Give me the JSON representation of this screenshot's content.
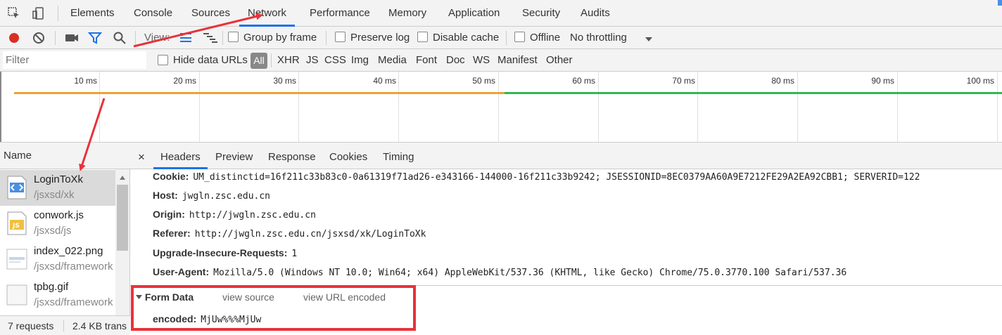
{
  "tabbar": {
    "tabs": [
      "Elements",
      "Console",
      "Sources",
      "Network",
      "Performance",
      "Memory",
      "Application",
      "Security",
      "Audits"
    ],
    "active": "Network"
  },
  "toolbar": {
    "view_label": "View:",
    "group_by_frame": "Group by frame",
    "preserve_log": "Preserve log",
    "disable_cache": "Disable cache",
    "offline": "Offline",
    "throttling": "No throttling"
  },
  "filter": {
    "placeholder": "Filter",
    "hide_data_urls": "Hide data URLs",
    "all": "All",
    "types": [
      "XHR",
      "JS",
      "CSS",
      "Img",
      "Media",
      "Font",
      "Doc",
      "WS",
      "Manifest",
      "Other"
    ]
  },
  "timeline": {
    "ticks": [
      "10 ms",
      "20 ms",
      "30 ms",
      "40 ms",
      "50 ms",
      "60 ms",
      "70 ms",
      "80 ms",
      "90 ms",
      "100 ms"
    ]
  },
  "requests": {
    "header": "Name",
    "items": [
      {
        "name": "LoginToXk",
        "path": "/jsxsd/xk",
        "selected": true
      },
      {
        "name": "conwork.js",
        "path": "/jsxsd/js",
        "selected": false
      },
      {
        "name": "index_022.png",
        "path": "/jsxsd/framework",
        "selected": false
      },
      {
        "name": "tpbg.gif",
        "path": "/jsxsd/framework",
        "selected": false
      }
    ],
    "status_count": "7 requests",
    "status_size": "2.4 KB trans"
  },
  "details": {
    "tabs": [
      "Headers",
      "Preview",
      "Response",
      "Cookies",
      "Timing"
    ],
    "active": "Headers",
    "close": "×",
    "headers": [
      {
        "key": "Cookie:",
        "value": "UM_distinctid=16f211c33b83c0-0a61319f71ad26-e343166-144000-16f211c33b9242; JSESSIONID=8EC0379AA60A9E7212FE29A2EA92CBB1; SERVERID=122"
      },
      {
        "key": "Host:",
        "value": "jwgln.zsc.edu.cn"
      },
      {
        "key": "Origin:",
        "value": "http://jwgln.zsc.edu.cn"
      },
      {
        "key": "Referer:",
        "value": "http://jwgln.zsc.edu.cn/jsxsd/xk/LoginToXk"
      },
      {
        "key": "Upgrade-Insecure-Requests:",
        "value": "1"
      },
      {
        "key": "User-Agent:",
        "value": "Mozilla/5.0 (Windows NT 10.0; Win64; x64) AppleWebKit/537.36 (KHTML, like Gecko) Chrome/75.0.3770.100 Safari/537.36"
      }
    ],
    "form_data": {
      "title": "Form Data",
      "view_source": "view source",
      "view_url_encoded": "view URL encoded",
      "key": "encoded:",
      "value": "MjUw%%%MjUw"
    }
  },
  "colors": {
    "accent": "#1a73e8",
    "record": "#d93025",
    "highlight": "#e8323a"
  }
}
